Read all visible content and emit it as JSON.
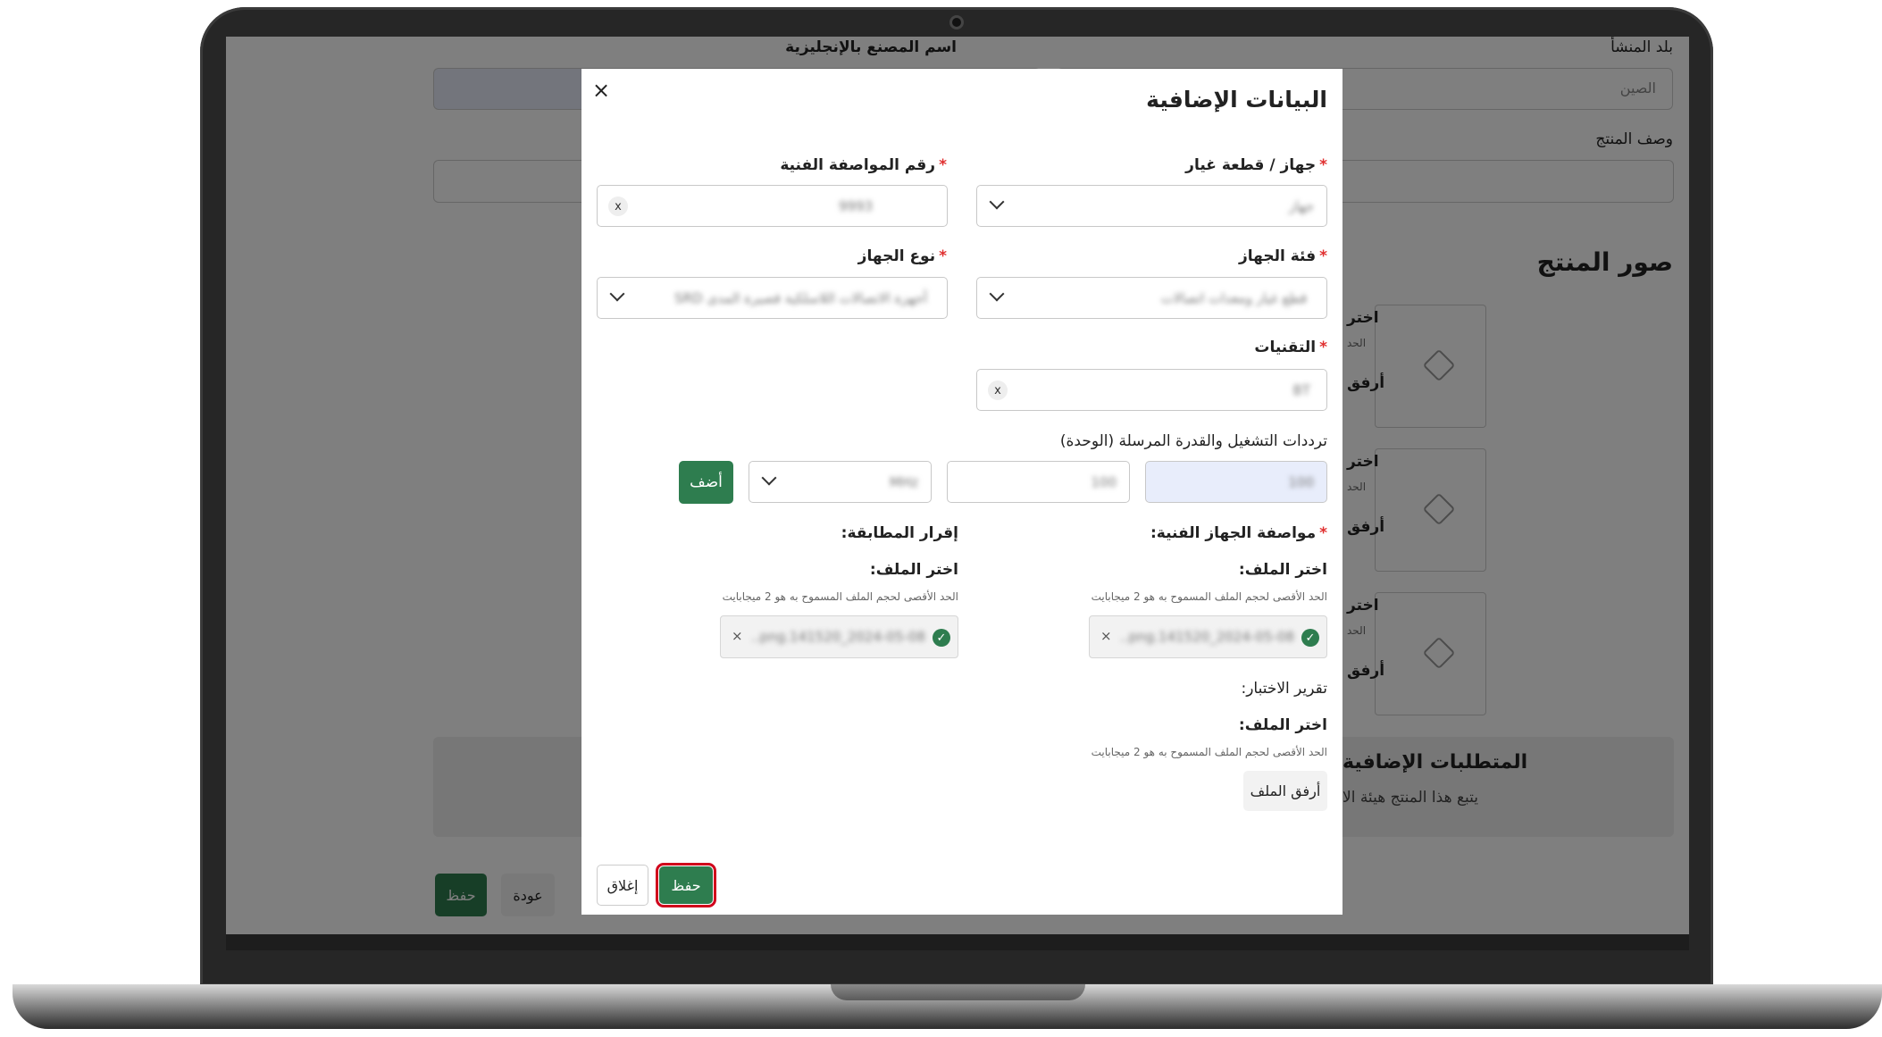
{
  "background_page": {
    "origin_label": "بلد المنشأ",
    "origin_value": "الصين",
    "factory_en_label": "اسم المصنع بالإنجليزية",
    "product_desc_label": "وصف المنتج",
    "product_images_heading": "صور المنتج",
    "choose_fragment": "اختر",
    "limit_fragment": "الحد",
    "attach_fragment": "أرفق",
    "extra_requirements_heading": "المتطلبات الإضافية",
    "extra_requirements_text": "يتبع هذا المنتج هيئة الا",
    "save_label": "حفظ",
    "back_label": "عودة"
  },
  "modal": {
    "title": "البيانات الإضافية",
    "close_icon": "×",
    "device_part": {
      "label": "جهاز / قطعة غيار",
      "value": "جهاز"
    },
    "spec_number": {
      "label": "رقم المواصفة الفنية",
      "chip": "9993",
      "chip_x": "x"
    },
    "device_category": {
      "label": "فئة الجهاز",
      "value": "قطع غيار ومعدات اتصالات"
    },
    "device_type": {
      "label": "نوع الجهاز",
      "value": "أجهزة الاتصالات اللاسلكية قصيرة المدى SRD"
    },
    "technologies": {
      "label": "التقنيات",
      "chip": "BT",
      "chip_x": "x"
    },
    "frequencies": {
      "label": "ترددات التشغيل والقدرة المرسلة (الوحدة)",
      "field1": "100",
      "field2": "100",
      "unit_select": "MHz",
      "add_label": "أضف"
    },
    "tech_spec_doc": {
      "label": "مواصفة الجهاز الفنية:",
      "choose": "اختر الملف:",
      "hint": "الحد الأقصى لحجم الملف المسموح به هو 2 ميجابايت",
      "file_name": "2024-05-08_141520.png..",
      "remove": "×"
    },
    "conformity": {
      "label": "إقرار المطابقة:",
      "choose": "اختر الملف:",
      "hint": "الحد الأقصى لحجم الملف المسموح به هو 2 ميجابايت",
      "file_name": "2024-05-08_141520.png..",
      "remove": "×"
    },
    "test_report": {
      "label": "تقرير الاختبار:",
      "choose": "اختر الملف:",
      "hint": "الحد الأقصى لحجم الملف المسموح به هو 2 ميجابايت",
      "attach_label": "أرفق الملف"
    },
    "footer": {
      "save_label": "حفظ",
      "close_label": "إغلاق"
    }
  },
  "colors": {
    "accent_green": "#2e7d4f",
    "highlight_red": "#d0021b",
    "required_red": "#e03030"
  }
}
